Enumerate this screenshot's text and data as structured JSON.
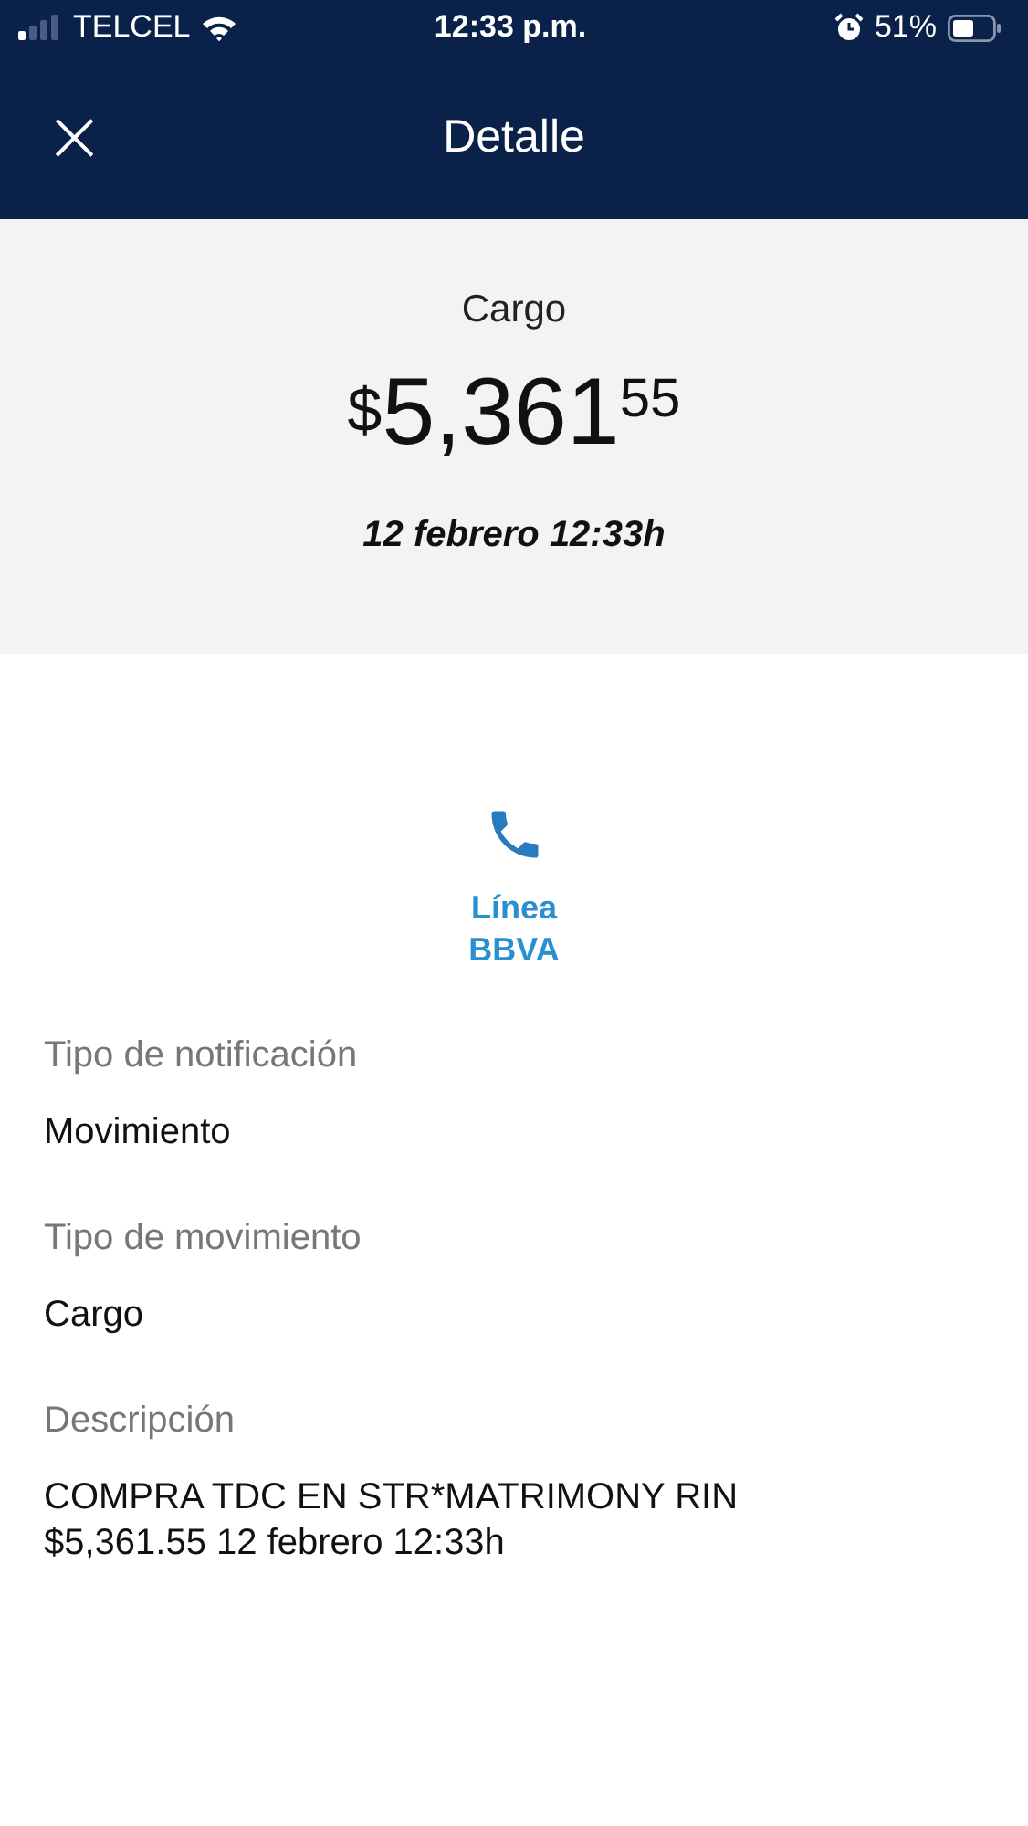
{
  "status_bar": {
    "carrier": "TELCEL",
    "time": "12:33 p.m.",
    "battery": "51%"
  },
  "header": {
    "close": "×",
    "title": "Detalle"
  },
  "summary": {
    "type": "Cargo",
    "currency": "$",
    "whole": "5,361",
    "cents": "55",
    "date": "12 febrero 12:33h"
  },
  "contact": {
    "label": "Línea BBVA"
  },
  "fields": [
    {
      "label": "Tipo de notificación",
      "value": "Movimiento"
    },
    {
      "label": "Tipo de movimiento",
      "value": "Cargo"
    },
    {
      "label": "Descripción",
      "value": "COMPRA TDC EN STR*MATRIMONY RIN $5,361.55 12 febrero 12:33h"
    }
  ]
}
